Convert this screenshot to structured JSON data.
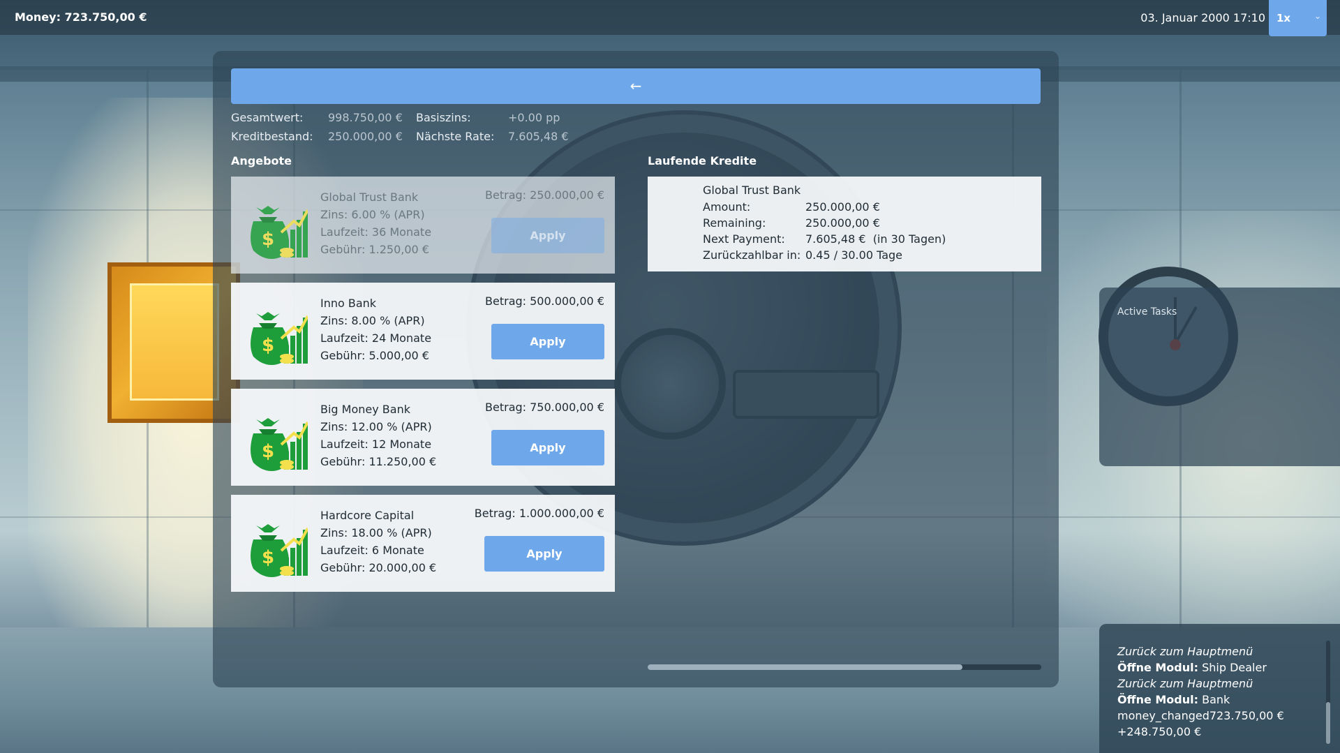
{
  "topbar": {
    "money": "Money: 723.750,00 €",
    "datetime": "03. Januar 2000 17:10",
    "speed": "1x"
  },
  "back_button": {
    "label": "←"
  },
  "stats": {
    "gesamtwert_label": "Gesamtwert:",
    "gesamtwert_value": "998.750,00 €",
    "kreditbestand_label": "Kreditbestand:",
    "kreditbestand_value": "250.000,00 €",
    "basiszins_label": "Basiszins:",
    "basiszins_value": "+0.00 pp",
    "naechste_rate_label": "Nächste Rate:",
    "naechste_rate_value": "7.605,48 €"
  },
  "offers_title": "Angebote",
  "offers": [
    {
      "bank": "Global Trust Bank",
      "zins": "Zins: 6.00 % (APR)",
      "laufzeit": "Laufzeit: 36 Monate",
      "gebuehr": "Gebühr: 1.250,00 €",
      "betrag": "Betrag: 250.000,00 €",
      "apply": "Apply",
      "disabled": true
    },
    {
      "bank": "Inno Bank",
      "zins": "Zins: 8.00 % (APR)",
      "laufzeit": "Laufzeit: 24 Monate",
      "gebuehr": "Gebühr: 5.000,00 €",
      "betrag": "Betrag: 500.000,00 €",
      "apply": "Apply",
      "disabled": false
    },
    {
      "bank": "Big Money Bank",
      "zins": "Zins: 12.00 % (APR)",
      "laufzeit": "Laufzeit: 12 Monate",
      "gebuehr": "Gebühr: 11.250,00 €",
      "betrag": "Betrag: 750.000,00 €",
      "apply": "Apply",
      "disabled": false
    },
    {
      "bank": "Hardcore Capital",
      "zins": "Zins: 18.00 % (APR)",
      "laufzeit": "Laufzeit: 6 Monate",
      "gebuehr": "Gebühr: 20.000,00 €",
      "betrag": "Betrag: 1.000.000,00 €",
      "apply": "Apply",
      "disabled": false
    }
  ],
  "credits_title": "Laufende Kredite",
  "credits": [
    {
      "bank": "Global Trust Bank",
      "amount_label": "Amount:",
      "amount_value": "250.000,00 €",
      "remaining_label": "Remaining:",
      "remaining_value": "250.000,00 €",
      "next_payment_label": "Next Payment:",
      "next_payment_value": "7.605,48 €  (in 30 Tagen)",
      "payback_label": "Zurückzahlbar in:",
      "payback_value": "0.45 / 30.00 Tage"
    }
  ],
  "credits_scroll_fraction": 0.8,
  "tasks": {
    "title": "Active Tasks"
  },
  "log": [
    {
      "italic": "Zurück zum Hauptmenü"
    },
    {
      "bold": "Öffne Modul:",
      "text": " Ship Dealer"
    },
    {
      "italic": "Zurück zum Hauptmenü"
    },
    {
      "bold": "Öffne Modul:",
      "text": " Bank"
    },
    {
      "text": "money_changed723.750,00 €"
    },
    {
      "text": "+248.750,00 €"
    }
  ],
  "colors": {
    "accent": "#6fa8ea",
    "money_green": "#1e9e3a",
    "coin_yellow": "#f4e04d"
  },
  "icons": {
    "offer_icon": "money-bag-chart-icon",
    "back_icon": "arrow-left-icon"
  }
}
